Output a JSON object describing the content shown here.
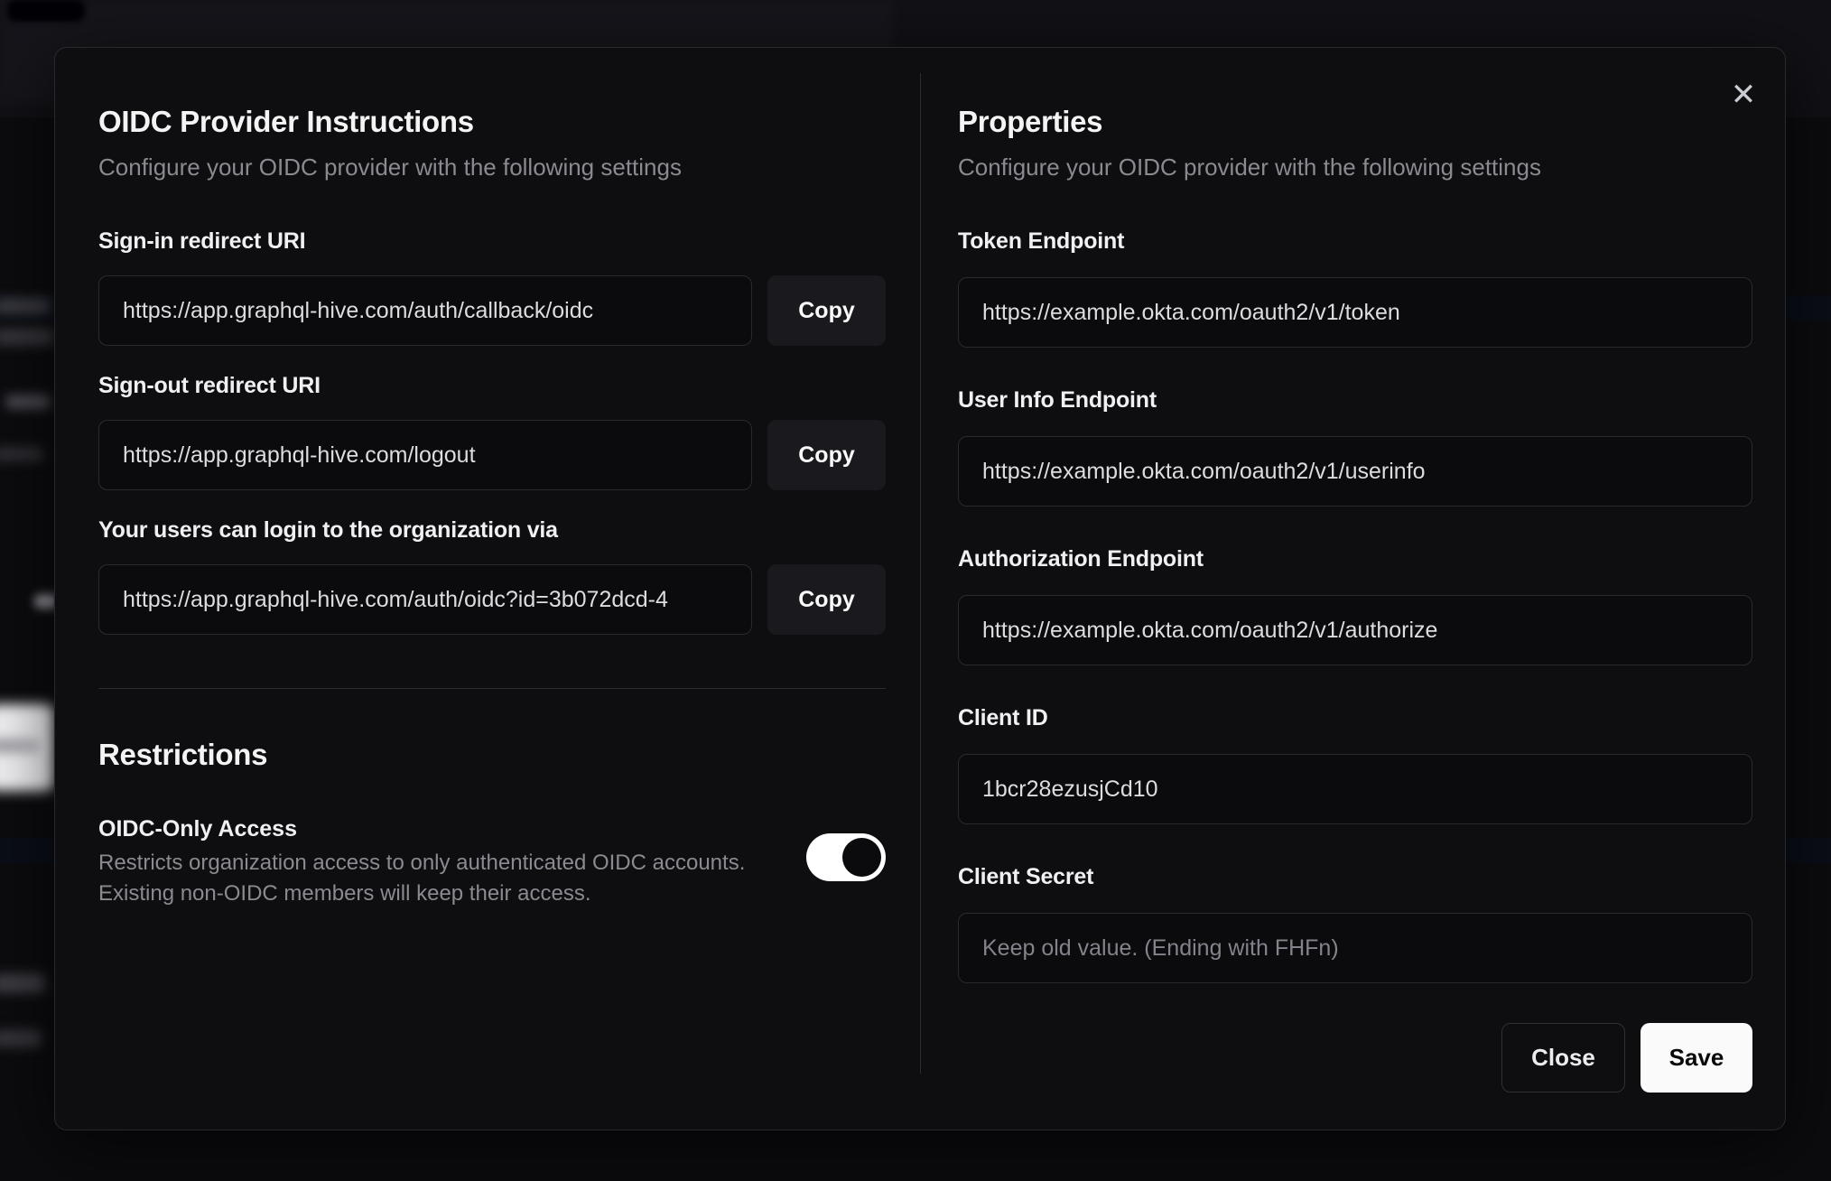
{
  "icons": {
    "close": "✕"
  },
  "colors": {
    "page_bg": "#0c0c0f",
    "modal_bg": "#0e0e11",
    "border": "#2a2a2e",
    "accent_button": "#fafafa",
    "toggle_on_track": "#ffffff",
    "muted_text": "#8a8a91"
  },
  "modal": {
    "instructions": {
      "title": "OIDC Provider Instructions",
      "subtitle": "Configure your OIDC provider with the following settings",
      "copy_label": "Copy",
      "fields": [
        {
          "label": "Sign-in redirect URI",
          "value": "https://app.graphql-hive.com/auth/callback/oidc"
        },
        {
          "label": "Sign-out redirect URI",
          "value": "https://app.graphql-hive.com/logout"
        },
        {
          "label": "Your users can login to the organization via",
          "value": "https://app.graphql-hive.com/auth/oidc?id=3b072dcd-4"
        }
      ],
      "restrictions": {
        "title": "Restrictions",
        "oidc_only": {
          "label": "OIDC-Only Access",
          "description_lines": [
            "Restricts organization access to only authenticated OIDC accounts.",
            "Existing non-OIDC members will keep their access."
          ],
          "enabled": true
        }
      }
    },
    "properties": {
      "title": "Properties",
      "subtitle": "Configure your OIDC provider with the following settings",
      "fields": [
        {
          "label": "Token Endpoint",
          "value": "https://example.okta.com/oauth2/v1/token",
          "placeholder": ""
        },
        {
          "label": "User Info Endpoint",
          "value": "https://example.okta.com/oauth2/v1/userinfo",
          "placeholder": ""
        },
        {
          "label": "Authorization Endpoint",
          "value": "https://example.okta.com/oauth2/v1/authorize",
          "placeholder": ""
        },
        {
          "label": "Client ID",
          "value": "1bcr28ezusjCd10",
          "placeholder": ""
        },
        {
          "label": "Client Secret",
          "value": "",
          "placeholder": "Keep old value. (Ending with FHFn)"
        }
      ],
      "actions": {
        "close": "Close",
        "save": "Save"
      }
    }
  }
}
